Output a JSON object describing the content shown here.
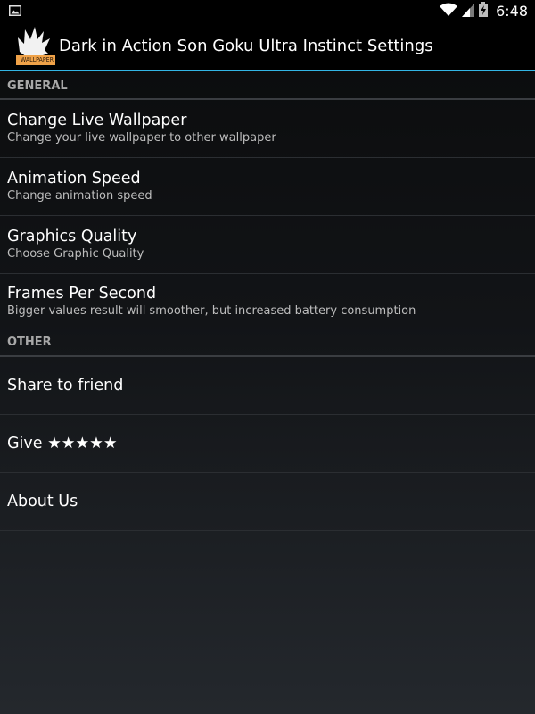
{
  "status_bar": {
    "time": "6:48",
    "icons": [
      "image-notification-icon",
      "wifi-icon",
      "cell-signal-icon",
      "battery-charging-icon"
    ]
  },
  "action_bar": {
    "title": "Dark in Action Son Goku Ultra Instinct Settings",
    "icon_badge_text": "WALLPAPER"
  },
  "categories": {
    "general": {
      "label": "GENERAL",
      "items": [
        {
          "title": "Change Live Wallpaper",
          "summary": "Change your live wallpaper to other wallpaper"
        },
        {
          "title": "Animation Speed",
          "summary": "Change animation speed"
        },
        {
          "title": "Graphics Quality",
          "summary": "Choose Graphic Quality"
        },
        {
          "title": "Frames Per Second",
          "summary": "Bigger values result will smoother, but increased battery consumption"
        }
      ]
    },
    "other": {
      "label": "OTHER",
      "items": [
        {
          "title": "Share to friend"
        },
        {
          "title": "Give ★★★★★"
        },
        {
          "title": "About Us"
        }
      ]
    }
  },
  "colors": {
    "accent": "#33b5e5",
    "badge": "#f0a248"
  }
}
